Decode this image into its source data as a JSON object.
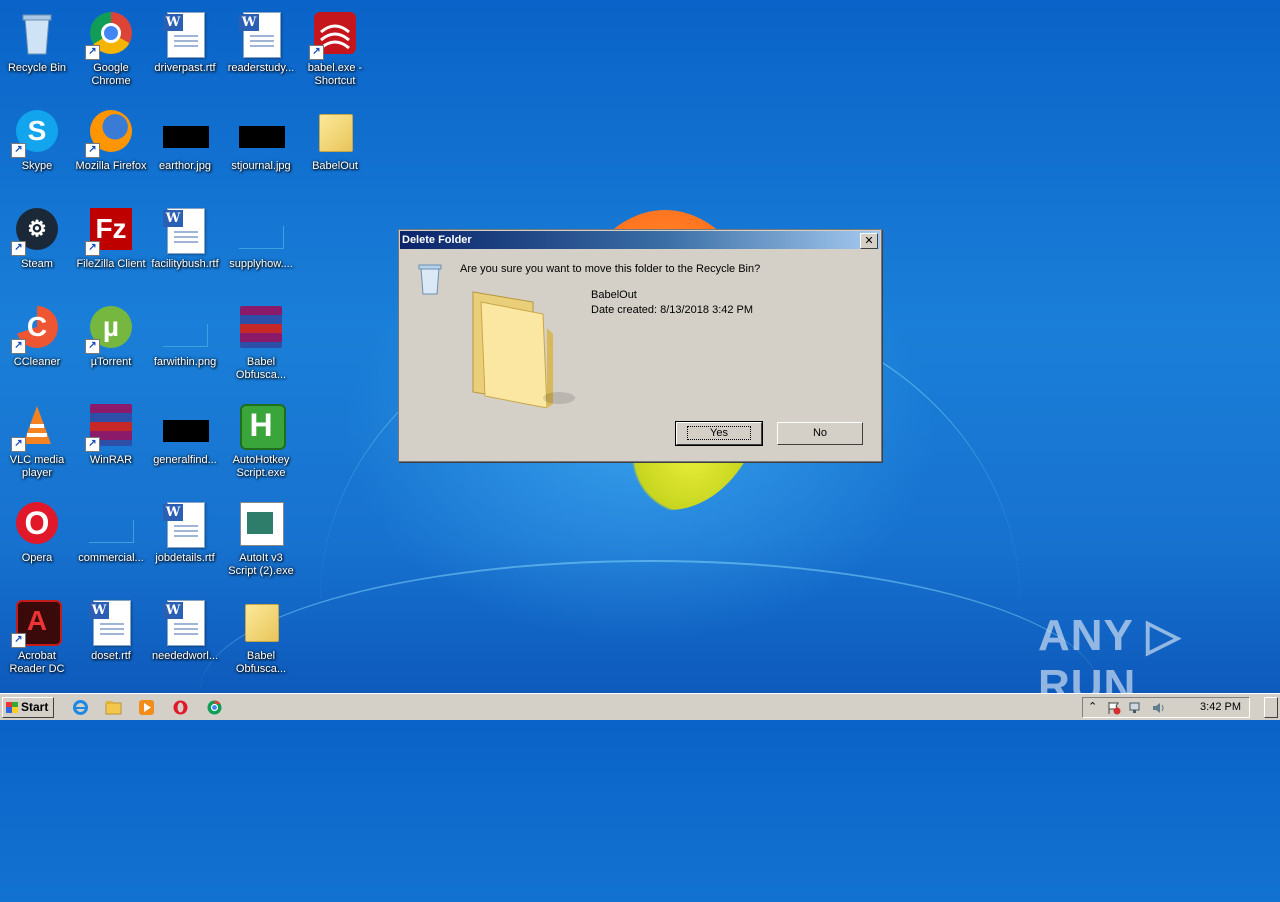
{
  "desktop": {
    "icons": [
      {
        "label": "Recycle Bin"
      },
      {
        "label": "Google Chrome"
      },
      {
        "label": "driverpast.rtf"
      },
      {
        "label": "readerstudy..."
      },
      {
        "label": "babel.exe - Shortcut"
      },
      {
        "label": "Skype"
      },
      {
        "label": "Mozilla Firefox"
      },
      {
        "label": "earthor.jpg"
      },
      {
        "label": "stjournal.jpg"
      },
      {
        "label": "BabelOut"
      },
      {
        "label": "Steam"
      },
      {
        "label": "FileZilla Client"
      },
      {
        "label": "facilitybush.rtf"
      },
      {
        "label": "supplyhow...."
      },
      {
        "label": "CCleaner"
      },
      {
        "label": "µTorrent"
      },
      {
        "label": "farwithin.png"
      },
      {
        "label": "Babel Obfusca..."
      },
      {
        "label": "VLC media player"
      },
      {
        "label": "WinRAR"
      },
      {
        "label": "generalfind..."
      },
      {
        "label": "AutoHotkey Script.exe"
      },
      {
        "label": "Opera"
      },
      {
        "label": "commercial..."
      },
      {
        "label": "jobdetails.rtf"
      },
      {
        "label": "AutoIt v3 Script (2).exe"
      },
      {
        "label": "Acrobat Reader DC"
      },
      {
        "label": "doset.rtf"
      },
      {
        "label": "neededworl..."
      },
      {
        "label": "Babel Obfusca..."
      }
    ]
  },
  "dialog": {
    "title": "Delete Folder",
    "close_glyph": "✕",
    "question": "Are you sure you want to move this folder to the Recycle Bin?",
    "folder_name": "BabelOut",
    "date_created": "Date created: 8/13/2018 3:42 PM",
    "yes_label": "Yes",
    "no_label": "No"
  },
  "taskbar": {
    "start_label": "Start",
    "clock": "3:42 PM",
    "tray_arrow": "⌃"
  },
  "watermark": "ANY ▷ RUN",
  "colors": {
    "desktop_blue": "#1a7fd8",
    "title_gradient_start": "#0a246a",
    "dialog_bg": "#d4d0c8"
  }
}
